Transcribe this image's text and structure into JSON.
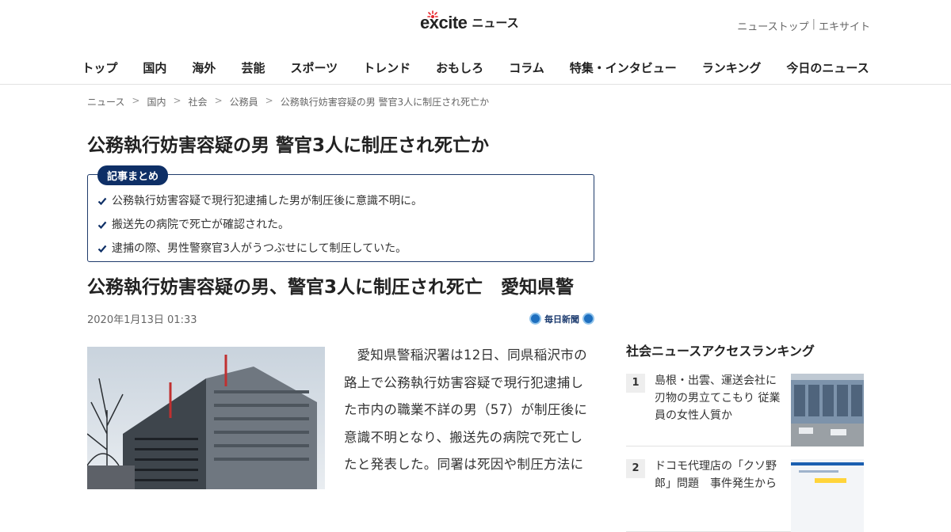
{
  "header": {
    "logo_text": "excite",
    "logo_sub": "ニュース",
    "top_links": [
      "ニューストップ",
      "エキサイト"
    ],
    "top_link_sep": "|"
  },
  "nav": {
    "items": [
      "トップ",
      "国内",
      "海外",
      "芸能",
      "スポーツ",
      "トレンド",
      "おもしろ",
      "コラム",
      "特集・インタビュー",
      "ランキング",
      "今日のニュース"
    ]
  },
  "breadcrumb": {
    "items": [
      "ニュース",
      "国内",
      "社会",
      "公務員",
      "公務執行妨害容疑の男 警官3人に制圧され死亡か"
    ],
    "sep": ">"
  },
  "article": {
    "page_title": "公務執行妨害容疑の男 警官3人に制圧され死亡か",
    "summary_label": "記事まとめ",
    "summary_items": [
      "公務執行妨害容疑で現行犯逮捕した男が制圧後に意識不明に。",
      "搬送先の病院で死亡が確認された。",
      "逮捕の際、男性警察官3人がうつぶせにして制圧していた。"
    ],
    "headline": "公務執行妨害容疑の男、警官3人に制圧され死亡　愛知県警",
    "date": "2020年1月13日 01:33",
    "source": "毎日新聞",
    "body": "愛知県警稲沢署は12日、同県稲沢市の路上で公務執行妨害容疑で現行犯逮捕した市内の職業不詳の男（57）が制圧後に意識不明となり、搬送先の病院で死亡したと発表した。同署は死因や制圧方法に"
  },
  "sidebar": {
    "title": "社会ニュースアクセスランキング",
    "ranking": [
      {
        "rank": "1",
        "text": "島根・出雲、運送会社に刃物の男立てこもり 従業員の女性人質か"
      },
      {
        "rank": "2",
        "text": "ドコモ代理店の「クソ野郎」問題　事件発生から"
      }
    ]
  },
  "icons": {
    "summary_check": "check-icon",
    "logo_mark": "burst-icon",
    "source_mark": "mainichi-logo-icon"
  },
  "colors": {
    "accent_navy": "#0e2f66",
    "border_navy": "#1f3b6b",
    "logo_red": "#e6262c"
  }
}
